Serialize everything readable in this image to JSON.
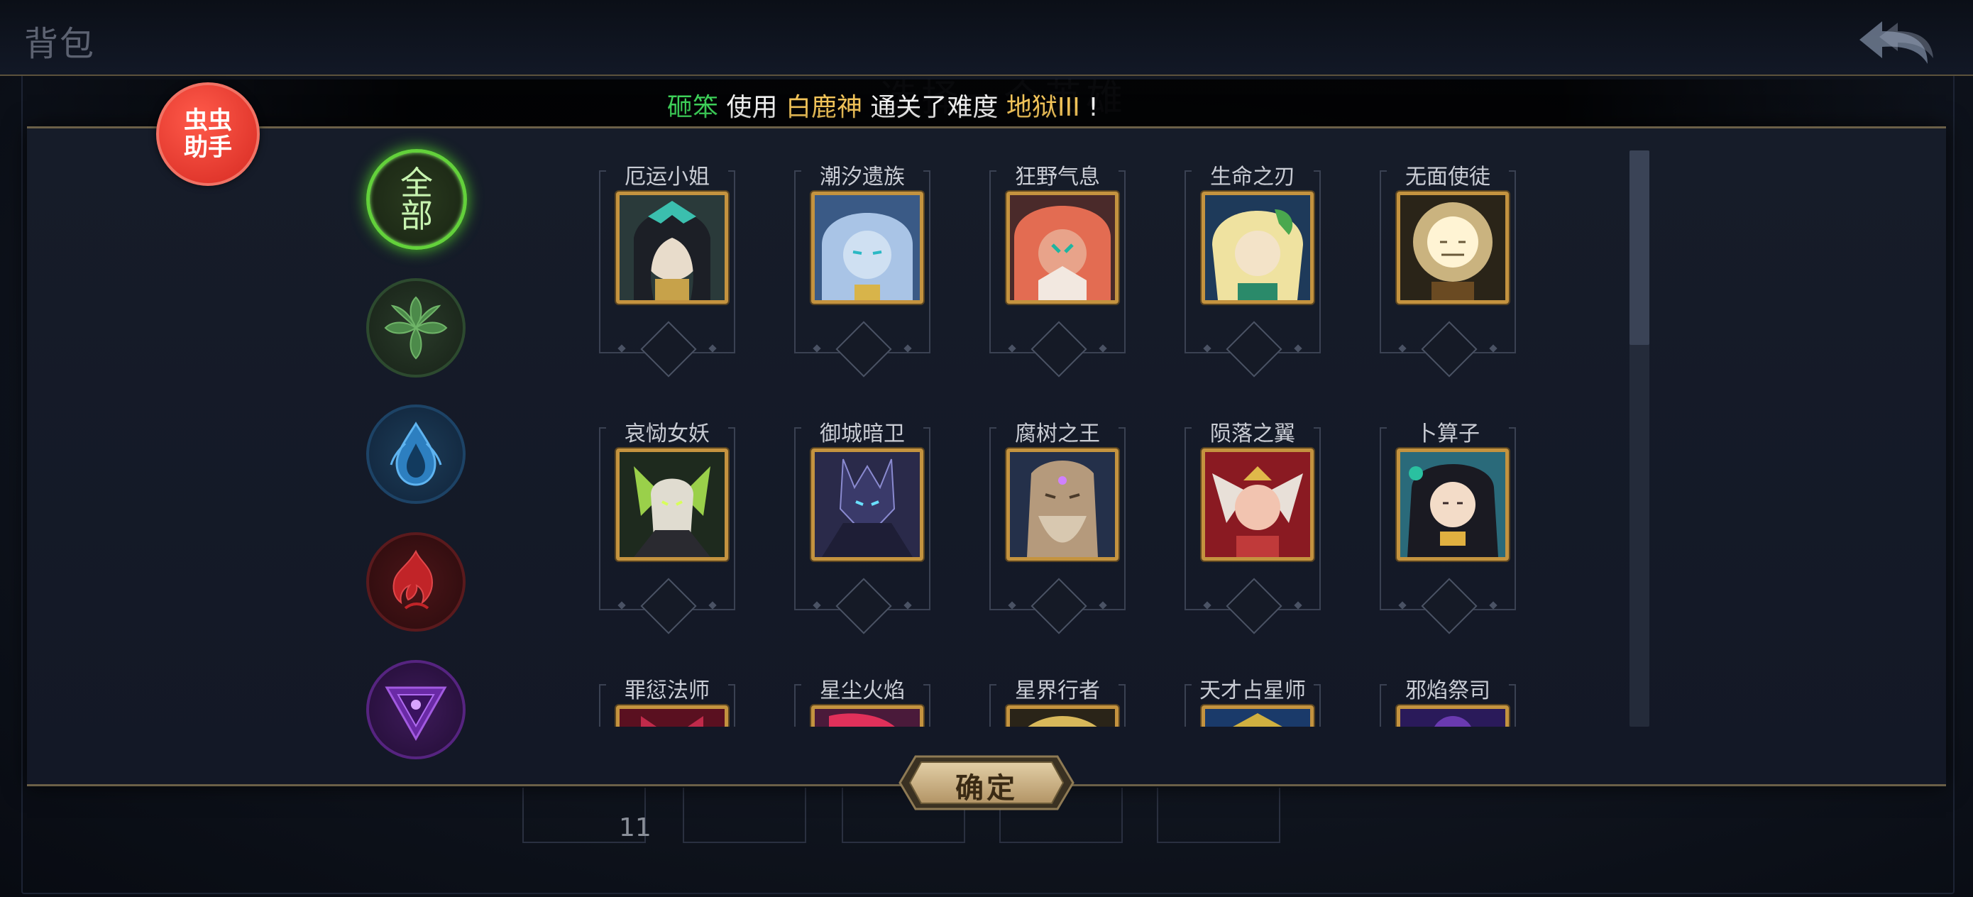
{
  "header": {
    "bag_title": "背包",
    "background_title": "选择一个英雄"
  },
  "announcement": {
    "player": "砸笨",
    "text1": "使用",
    "hero": "白鹿神",
    "text2": "通关了难度",
    "difficulty": "地狱III",
    "text3": "!"
  },
  "badge": {
    "label": "虫虫助手"
  },
  "filters": [
    {
      "id": "all",
      "label": "全部",
      "icon": "all-heroes-icon",
      "active": true
    },
    {
      "id": "nature",
      "icon": "leaf-icon",
      "active": false
    },
    {
      "id": "water",
      "icon": "water-drop-icon",
      "active": false
    },
    {
      "id": "fire",
      "icon": "flame-icon",
      "active": false
    },
    {
      "id": "arcane",
      "icon": "arcane-triangle-icon",
      "active": false
    }
  ],
  "heroes": [
    {
      "name": "厄运小姐"
    },
    {
      "name": "潮汐遗族"
    },
    {
      "name": "狂野气息"
    },
    {
      "name": "生命之刃"
    },
    {
      "name": "无面使徒"
    },
    {
      "name": "哀恸女妖"
    },
    {
      "name": "御城暗卫"
    },
    {
      "name": "腐树之王"
    },
    {
      "name": "陨落之翼"
    },
    {
      "name": "卜算子"
    },
    {
      "name": "罪愆法师"
    },
    {
      "name": "星尘火焰"
    },
    {
      "name": "星界行者"
    },
    {
      "name": "天才占星师"
    },
    {
      "name": "邪焰祭司"
    }
  ],
  "confirm_button": {
    "label": "确定"
  },
  "background_slot": {
    "count": "11"
  },
  "colors": {
    "gold_frame": "#c4933f",
    "active_green": "#63d13b",
    "announce_green": "#3ed25a",
    "announce_gold": "#f3c55a"
  }
}
